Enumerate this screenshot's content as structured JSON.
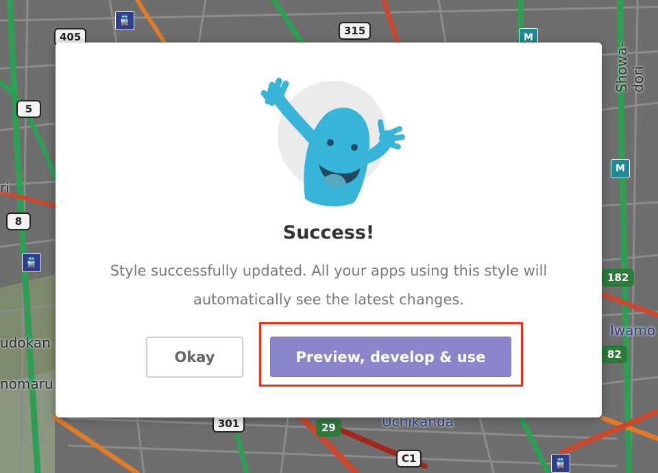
{
  "map": {
    "route_shields": [
      "405",
      "315",
      "5",
      "8",
      "301",
      "C1"
    ],
    "green_shields": [
      "182",
      "82",
      "29"
    ],
    "place_labels": [
      "Showa-dori",
      "Iwamo",
      "udokan",
      "nomaru",
      "Uchikanda",
      "ri"
    ],
    "station_icons": [
      "train-icon",
      "metro-icon"
    ]
  },
  "dialog": {
    "title": "Success!",
    "message": "Style successfully updated. All your apps using this style will automatically see the latest changes.",
    "okay_label": "Okay",
    "primary_label": "Preview, develop & use"
  },
  "colors": {
    "primary_button": "#8b86cc",
    "highlight_box": "#ff2a12",
    "mascot_body": "#37b4d8",
    "mascot_circle": "#ebebeb"
  }
}
